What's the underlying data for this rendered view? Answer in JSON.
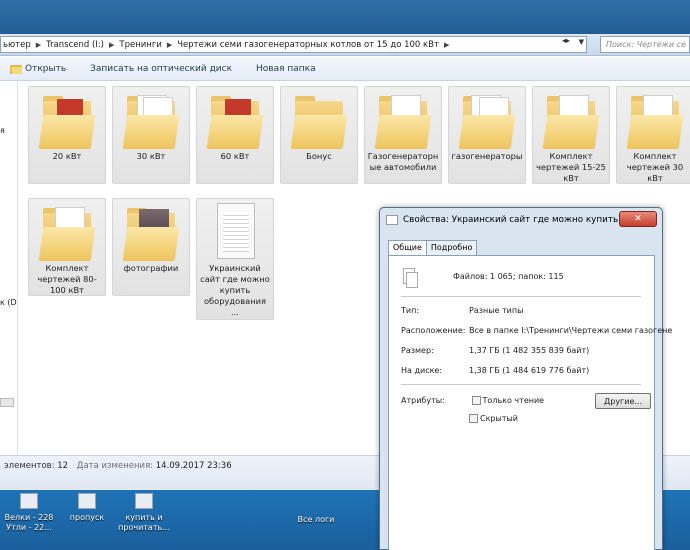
{
  "address": {
    "crumbs": [
      "ьютер",
      "Transcend (I:)",
      "Тренинги",
      "Чертежи семи газогенераторных котлов от 15 до 100 кВт"
    ],
    "search_placeholder": "Поиск: Чертежи се"
  },
  "toolbar": {
    "open": "Открыть",
    "burn": "Записать на оптический диск",
    "new_folder": "Новая папка"
  },
  "navpane": {
    "frag_top": "я",
    "frag_drive": "к (D"
  },
  "items": [
    {
      "label": "20 кВт",
      "icon": "folder-red-icon"
    },
    {
      "label": "30 кВт",
      "icon": "folder-docs-icon"
    },
    {
      "label": "60 кВт",
      "icon": "folder-red-icon"
    },
    {
      "label": "Бонус",
      "icon": "folder-empty-icon"
    },
    {
      "label": "Газогенераторн ые автомобили",
      "icon": "folder-docs-icon"
    },
    {
      "label": "газогенераторы",
      "icon": "folder-docs-icon"
    },
    {
      "label": "Комплект чертежей 15-25 кВт",
      "icon": "folder-docs-icon"
    },
    {
      "label": "Комплект чертежей 30 кВт",
      "icon": "folder-docs-icon"
    },
    {
      "label": "Комплект чертежей 80-100 кВт",
      "icon": "folder-docs-icon"
    },
    {
      "label": "фотографии",
      "icon": "folder-photo-icon"
    },
    {
      "label": "Украинский сайт где можно купить оборудования ...",
      "icon": "document-icon"
    }
  ],
  "status": {
    "count_key": "элементов:",
    "count_val": "12",
    "modified_key": "Дата изменения:",
    "modified_val": "14.09.2017 23:36"
  },
  "desktop": {
    "icons": [
      "Велки - 228 Утли - 22...",
      "пропуск",
      "купить и прочитать...",
      "Все логи"
    ]
  },
  "dialog": {
    "title": "Свойства: Украинский сайт где можно купить обор...",
    "close": "✕",
    "tabs": [
      "Общие",
      "Подробно"
    ],
    "summary": "Файлов: 1 065; папок: 115",
    "type_key": "Тип:",
    "type_val": "Разные типы",
    "location_key": "Расположение:",
    "location_val": "Все в папке I:\\Тренинги\\Чертежи семи газогене",
    "size_key": "Размер:",
    "size_val": "1,37 ГБ (1 482 355 839 байт)",
    "disk_key": "На диске:",
    "disk_val": "1,38 ГБ (1 484 619 776 байт)",
    "attr_key": "Атрибуты:",
    "readonly": "Только чтение",
    "hidden": "Скрытый",
    "other_btn": "Другие..."
  }
}
